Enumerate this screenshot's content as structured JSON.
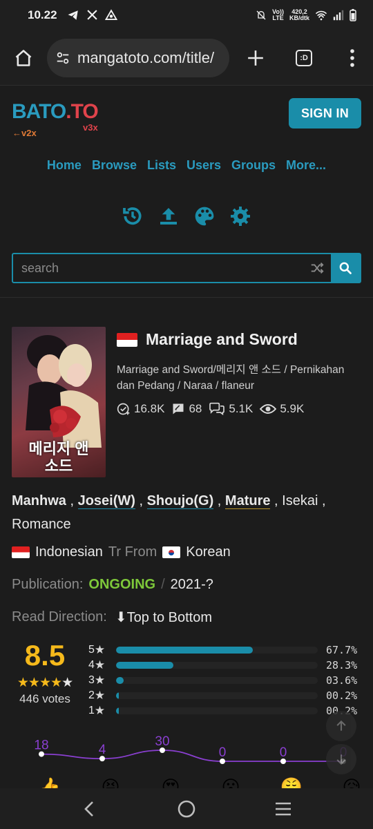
{
  "status_bar": {
    "time": "10.22",
    "left_icons": [
      "telegram-icon",
      "x-icon",
      "app-icon"
    ],
    "net_speed_value": "420,2",
    "net_speed_unit": "KB/dtk",
    "signal_label_top": "Vo))",
    "signal_label_bottom": "LTE"
  },
  "browser": {
    "url": "mangatoto.com/title/",
    "tab_count": ":D"
  },
  "header": {
    "logo_bato": "BATO",
    "logo_dot": ".",
    "logo_to": "TO",
    "logo_v2x": "←v2x",
    "logo_v3x": "v3x",
    "signin_label": "SIGN IN"
  },
  "nav": {
    "items": [
      "Home",
      "Browse",
      "Lists",
      "Users",
      "Groups",
      "More..."
    ]
  },
  "tools": [
    "history-icon",
    "upload-icon",
    "palette-icon",
    "settings-icon"
  ],
  "search": {
    "placeholder": "search"
  },
  "manga": {
    "cover_text": "메리지 앤\n소드",
    "title": "Marriage and Sword",
    "alt_names": "Marriage and Sword/메리지 앤 소드 / Pernikahan dan Pedang / Naraa / flaneur",
    "stats": {
      "follows": "16.8K",
      "reviews": "68",
      "comments": "5.1K",
      "views": "5.9K"
    },
    "genres": {
      "g1": "Manhwa",
      "g2": "Josei(W)",
      "g3": "Shoujo(G)",
      "g4": "Mature",
      "g5": "Isekai",
      "g6": "Romance",
      "sep": " , "
    },
    "language": {
      "translated": "Indonesian",
      "tr_from": "Tr From",
      "original": "Korean"
    },
    "publication": {
      "label": "Publication:",
      "status": "ONGOING",
      "sep": "/",
      "years": "2021-?"
    },
    "read_direction": {
      "label": "Read Direction:",
      "value": "⬇Top to Bottom"
    },
    "rating": {
      "score": "8.5",
      "stars_filled": 4,
      "votes": "446 votes",
      "distribution": [
        {
          "star": "5",
          "pct_label": "67.7%",
          "pct": 67.7
        },
        {
          "star": "4",
          "pct_label": "28.3%",
          "pct": 28.3
        },
        {
          "star": "3",
          "pct_label": "03.6%",
          "pct": 3.6
        },
        {
          "star": "2",
          "pct_label": "00.2%",
          "pct": 0.2
        },
        {
          "star": "1",
          "pct_label": "00.2%",
          "pct": 0.2
        }
      ]
    },
    "reactions": [
      {
        "emoji": "👍",
        "count": "18"
      },
      {
        "emoji": "😝",
        "count": "4"
      },
      {
        "emoji": "😍",
        "count": "30"
      },
      {
        "emoji": "😮",
        "count": "0"
      },
      {
        "emoji": "😤",
        "count": "0"
      },
      {
        "emoji": "😥",
        "count": "0"
      }
    ]
  },
  "colors": {
    "accent": "#1a8da9",
    "logo_blue": "#2a9bbf",
    "logo_red": "#e0434b",
    "rating_gold": "#f5b91b",
    "ongoing_green": "#7ec83a",
    "reaction_line": "#8a3fd1"
  }
}
